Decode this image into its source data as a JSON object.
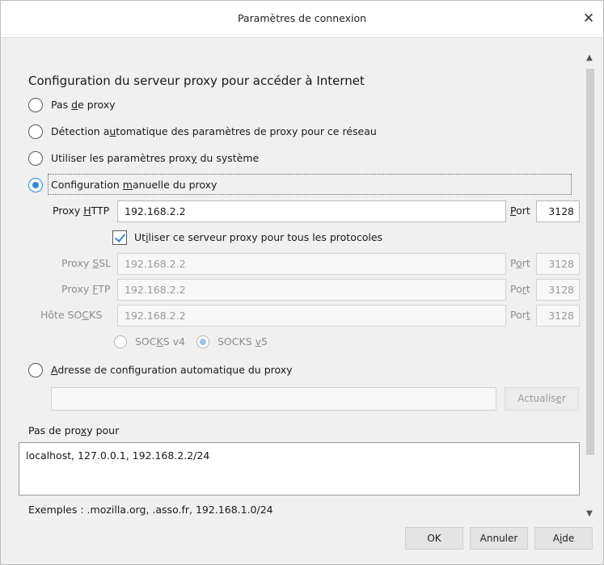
{
  "window": {
    "title": "Paramètres de connexion",
    "close_glyph": "✕"
  },
  "section": {
    "heading": "Configuration du serveur proxy pour accéder à Internet"
  },
  "options": {
    "no_proxy": {
      "pre": "Pas ",
      "key": "d",
      "post": "e proxy",
      "checked": false
    },
    "auto_detect": {
      "pre": "Détection a",
      "key": "u",
      "post": "tomatique des paramètres de proxy pour ce réseau",
      "checked": false
    },
    "system": {
      "pre": "Utiliser les paramètres prox",
      "key": "y",
      "post": " du système",
      "checked": false
    },
    "manual": {
      "pre": "Configuration ",
      "key": "m",
      "post": "anuelle du proxy",
      "checked": true
    },
    "auto_url": {
      "pre": "",
      "key": "A",
      "post": "dresse de configuration automatique du proxy",
      "checked": false
    }
  },
  "http": {
    "label_pre": "Proxy ",
    "label_key": "H",
    "label_post": "TTP",
    "value": "192.168.2.2",
    "port_label_key": "P",
    "port_label_post": "ort",
    "port": "3128"
  },
  "share": {
    "pre": "Ut",
    "key": "i",
    "post": "liser ce serveur proxy pour tous les protocoles",
    "checked": true
  },
  "ssl": {
    "label_pre": "Proxy ",
    "label_key": "S",
    "label_post": "SL",
    "value": "192.168.2.2",
    "port_label_pre": "P",
    "port_label_key": "o",
    "port_label_post": "rt",
    "port": "3128"
  },
  "ftp": {
    "label_pre": "Proxy ",
    "label_key": "F",
    "label_post": "TP",
    "value": "192.168.2.2",
    "port_label_pre": "Po",
    "port_label_key": "r",
    "port_label_post": "t",
    "port": "3128"
  },
  "socks": {
    "label_pre": "Hôte SO",
    "label_key": "C",
    "label_post": "KS",
    "value": "192.168.2.2",
    "port_label_pre": "Por",
    "port_label_key": "t",
    "port_label_post": "",
    "port": "3128",
    "v4_pre": "SOC",
    "v4_key": "K",
    "v4_post": "S v4",
    "v5_pre": "SOCKS ",
    "v5_key": "v",
    "v5_post": "5",
    "v5_checked": true
  },
  "autoconfig": {
    "url_value": "",
    "reload_pre": "Actualis",
    "reload_key": "e",
    "reload_post": "r"
  },
  "no_proxy_for": {
    "label_pre": "Pas de pro",
    "label_key": "x",
    "label_post": "y pour",
    "value": "localhost, 127.0.0.1, 192.168.2.2/24",
    "example": "Exemples : .mozilla.org, .asso.fr, 192.168.1.0/24"
  },
  "buttons": {
    "ok": "OK",
    "cancel": "Annuler",
    "help_pre": "A",
    "help_key": "i",
    "help_post": "de"
  },
  "scrollbar": {
    "up": "▲",
    "down": "▼"
  },
  "colors": {
    "accent": "#2f87e0",
    "accent_disabled": "#9cc3ea"
  }
}
